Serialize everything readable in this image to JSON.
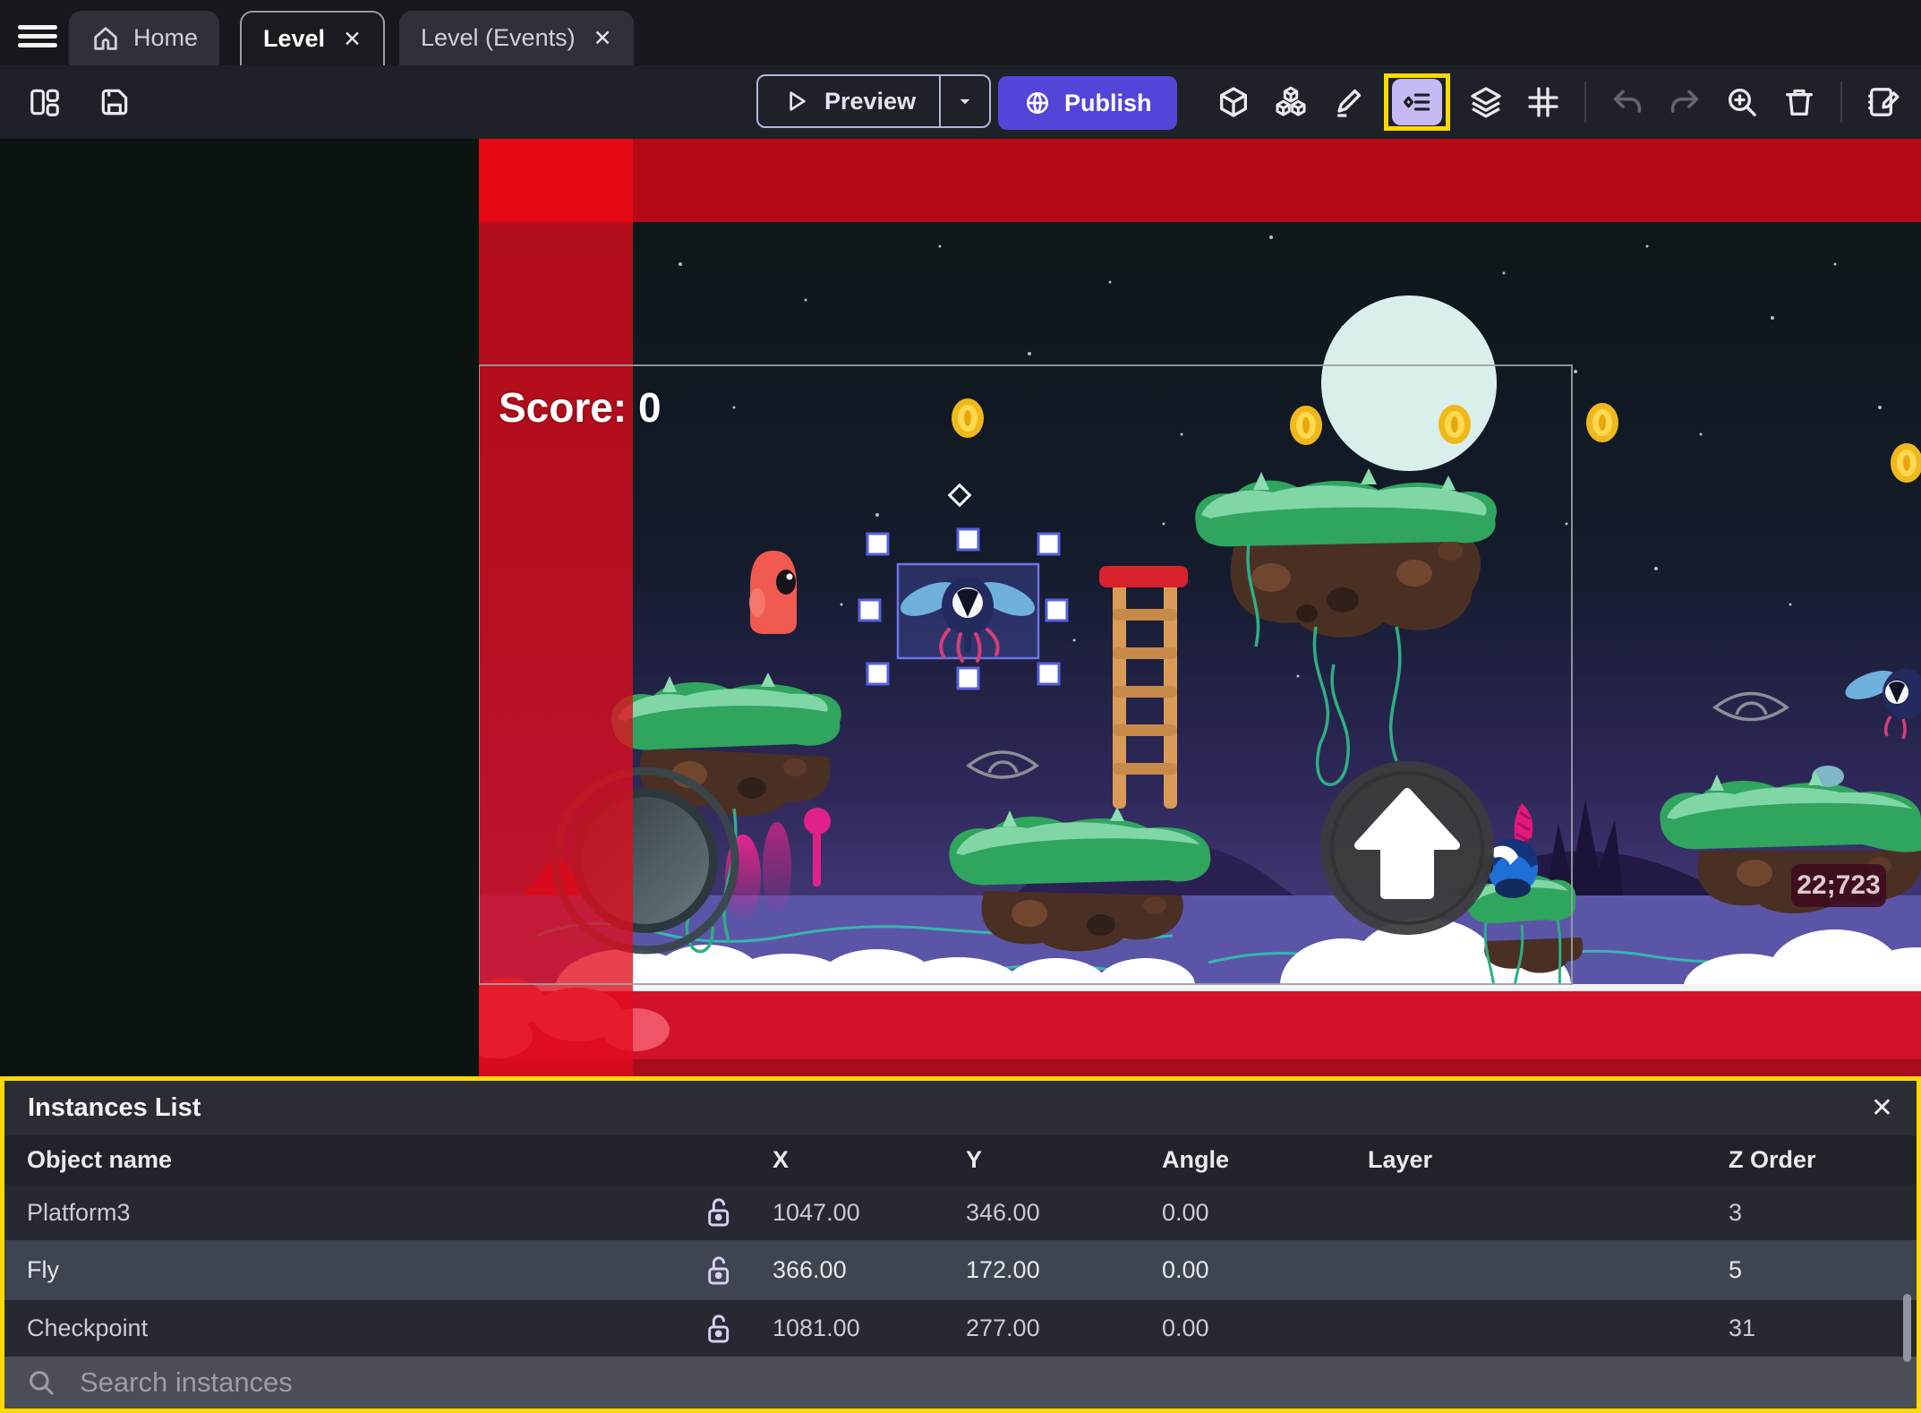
{
  "tabs": {
    "home": {
      "label": "Home"
    },
    "level": {
      "label": "Level",
      "close": "✕"
    },
    "level_events": {
      "label": "Level (Events)",
      "close": "✕"
    }
  },
  "toolbar": {
    "preview_label": "Preview",
    "publish_label": "Publish",
    "icons": [
      "layout-panels",
      "save",
      "preview-play",
      "preview-caret",
      "publish-globe",
      "objects-cube",
      "object-groups-cubes",
      "edit-pencil",
      "instances-list",
      "layers",
      "grid",
      "undo",
      "redo",
      "zoom-in",
      "trash",
      "edit-scene-properties"
    ]
  },
  "canvas": {
    "score_text": "Score: 0",
    "coords_badge": "22;723",
    "scene_objects": [
      "moon",
      "coin",
      "fly-enemy-selected",
      "player-character",
      "platform",
      "ladder",
      "checkpoint-diamond",
      "eye-placeholder",
      "blue-enemy",
      "joystick-control",
      "jump-button",
      "clouds",
      "water",
      "red-camera-band"
    ]
  },
  "instances_panel": {
    "title": "Instances List",
    "close": "✕",
    "columns": [
      "Object name",
      "X",
      "Y",
      "Angle",
      "Layer",
      "Z Order"
    ],
    "rows": [
      {
        "name": "Platform3",
        "x": "1047.00",
        "y": "346.00",
        "angle": "0.00",
        "layer": "",
        "z_order": "3",
        "highlighted": false
      },
      {
        "name": "Fly",
        "x": "366.00",
        "y": "172.00",
        "angle": "0.00",
        "layer": "",
        "z_order": "5",
        "highlighted": true
      },
      {
        "name": "Checkpoint",
        "x": "1081.00",
        "y": "277.00",
        "angle": "0.00",
        "layer": "",
        "z_order": "31",
        "highlighted": false
      }
    ],
    "search_placeholder": "Search instances"
  },
  "colors": {
    "publish_purple": "#5345d8",
    "highlight_yellow": "#ffd900",
    "selection_blue": "#6b74e6",
    "row_highlight": "#3e4450",
    "red_overlay": "#e30b1c",
    "toolbar_bg": "#1e2127",
    "panel_bg": "#262930"
  }
}
